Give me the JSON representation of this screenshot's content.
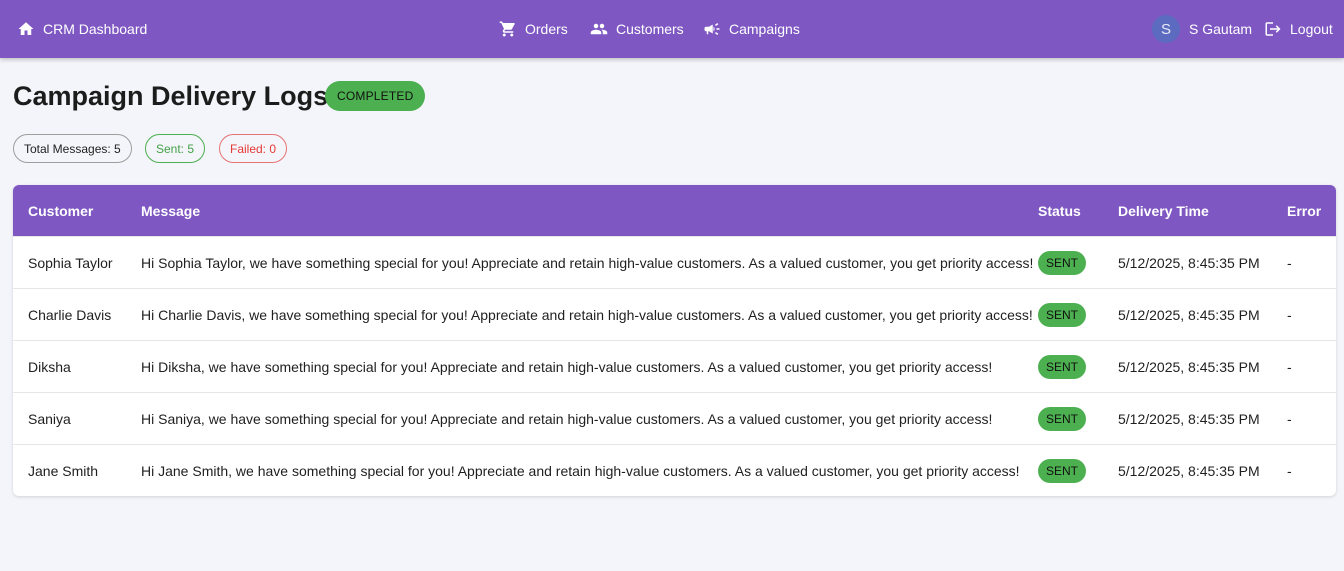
{
  "appbar": {
    "brand": "CRM Dashboard",
    "nav": [
      {
        "label": "Orders",
        "icon": "cart-icon"
      },
      {
        "label": "Customers",
        "icon": "people-icon"
      },
      {
        "label": "Campaigns",
        "icon": "megaphone-icon"
      }
    ],
    "user": {
      "initial": "S",
      "name": "S Gautam"
    },
    "logout": "Logout",
    "color": "#7e57c2"
  },
  "page": {
    "title": "Campaign Delivery Logs",
    "status": "COMPLETED",
    "status_color": "#4caf50"
  },
  "stats": {
    "total": "Total Messages: 5",
    "sent": "Sent: 5",
    "failed": "Failed: 0"
  },
  "table": {
    "columns": [
      "Customer",
      "Message",
      "Status",
      "Delivery Time",
      "Error"
    ],
    "rows": [
      {
        "customer": "Sophia Taylor",
        "message": "Hi Sophia Taylor, we have something special for you! Appreciate and retain high-value customers. As a valued customer, you get priority access!",
        "status": "SENT",
        "time": "5/12/2025, 8:45:35 PM",
        "error": "-"
      },
      {
        "customer": "Charlie Davis",
        "message": "Hi Charlie Davis, we have something special for you! Appreciate and retain high-value customers. As a valued customer, you get priority access!",
        "status": "SENT",
        "time": "5/12/2025, 8:45:35 PM",
        "error": "-"
      },
      {
        "customer": "Diksha",
        "message": "Hi Diksha, we have something special for you! Appreciate and retain high-value customers. As a valued customer, you get priority access!",
        "status": "SENT",
        "time": "5/12/2025, 8:45:35 PM",
        "error": "-"
      },
      {
        "customer": "Saniya",
        "message": "Hi Saniya, we have something special for you! Appreciate and retain high-value customers. As a valued customer, you get priority access!",
        "status": "SENT",
        "time": "5/12/2025, 8:45:35 PM",
        "error": "-"
      },
      {
        "customer": "Jane Smith",
        "message": "Hi Jane Smith, we have something special for you! Appreciate and retain high-value customers. As a valued customer, you get priority access!",
        "status": "SENT",
        "time": "5/12/2025, 8:45:35 PM",
        "error": "-"
      }
    ]
  }
}
